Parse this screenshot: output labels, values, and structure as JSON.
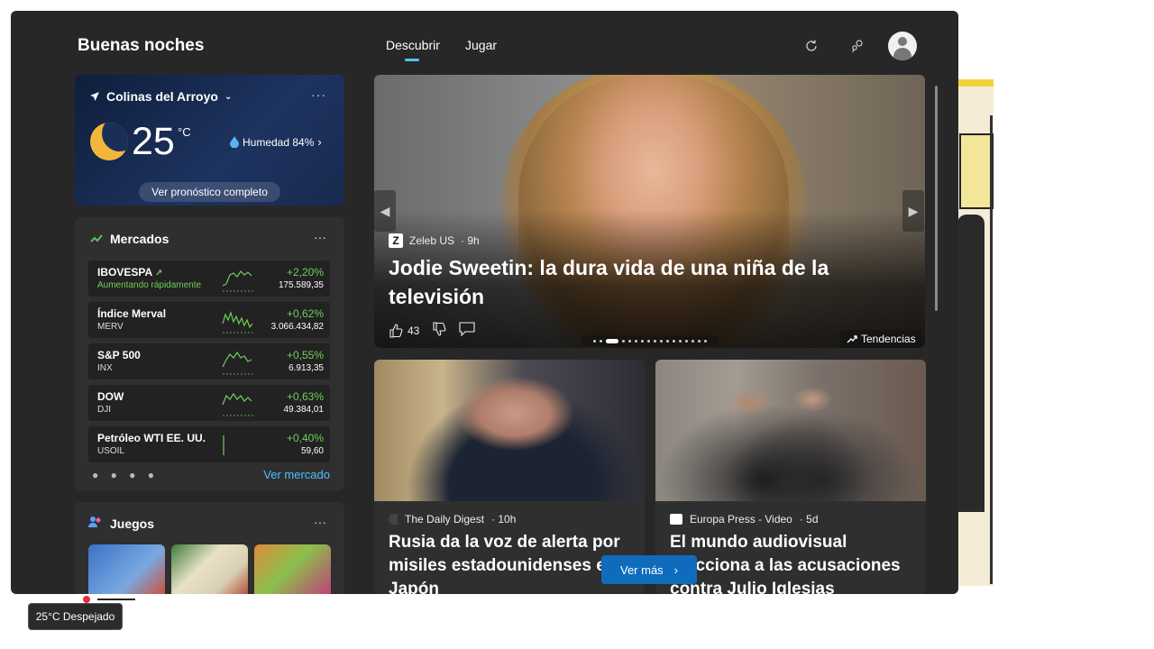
{
  "header": {
    "greeting": "Buenas noches",
    "tabs": [
      {
        "label": "Descubrir",
        "active": true
      },
      {
        "label": "Jugar",
        "active": false
      }
    ],
    "icons": [
      "refresh-icon",
      "feed-settings-icon",
      "profile-avatar"
    ]
  },
  "weather": {
    "location": "Colinas del Arroyo",
    "temperature": "25",
    "unit": "°C",
    "humidity": "Humedad 84%",
    "forecast_button": "Ver pronóstico completo",
    "more": "···"
  },
  "markets": {
    "title": "Mercados",
    "more": "···",
    "stocks": [
      {
        "name": "IBOVESPA",
        "sub": "Aumentando rápidamente",
        "pct": "+2,20%",
        "value": "175.589,35"
      },
      {
        "name": "Índice Merval",
        "sub": "MERV",
        "pct": "+0,62%",
        "value": "3.066.434,82"
      },
      {
        "name": "S&P 500",
        "sub": "INX",
        "pct": "+0,55%",
        "value": "6.913,35"
      },
      {
        "name": "DOW",
        "sub": "DJI",
        "pct": "+0,63%",
        "value": "49.384,01"
      },
      {
        "name": "Petróleo WTI EE. UU.",
        "sub": "USOIL",
        "pct": "+0,40%",
        "value": "59,60"
      }
    ],
    "pager": "● ● ● ●",
    "see_market": "Ver mercado"
  },
  "games": {
    "title": "Juegos",
    "more": "···"
  },
  "hero": {
    "source": "Zeleb US",
    "age": "· 9h",
    "headline": "Jodie Sweetin: la dura vida de una niña de la televisión",
    "likes": "43",
    "trend_label": "Tendencias"
  },
  "news": [
    {
      "source": "The Daily Digest",
      "age": "· 10h",
      "headline": "Rusia da la voz de alerta por misiles estadounidenses en Japón"
    },
    {
      "source": "Europa Press - Video",
      "age": "· 5d",
      "headline": "El mundo audiovisual reacciona a las acusaciones contra Julio Iglesias"
    }
  ],
  "see_more": "Ver más",
  "taskbar": {
    "weather_label": "25°C Despejado"
  },
  "colors": {
    "accent": "#4cc2ff",
    "positive": "#6fcf5a",
    "button": "#0f6cbd",
    "panel": "#272727"
  }
}
